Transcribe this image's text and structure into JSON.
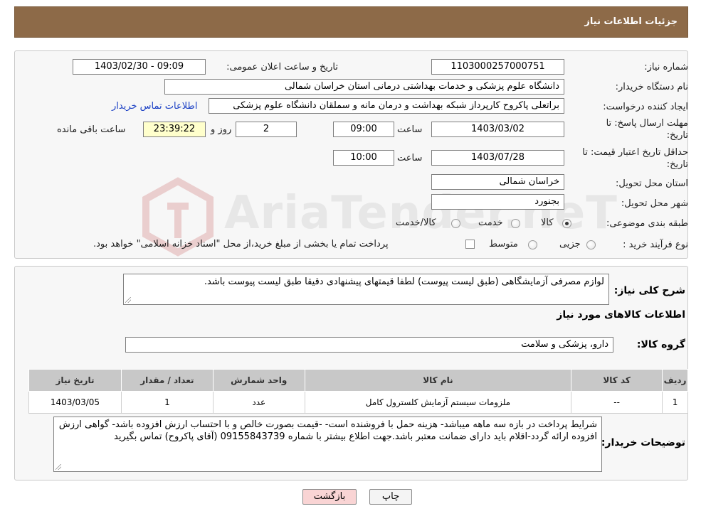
{
  "header": {
    "title": "جزئیات اطلاعات نیاز"
  },
  "watermark": {
    "brand": "AriaTender.neT"
  },
  "form": {
    "need_number": {
      "label": "شماره نیاز:",
      "value": "1103000257000751"
    },
    "announce_datetime": {
      "label": "تاریخ و ساعت اعلان عمومی:",
      "value": "1403/02/30 - 09:09"
    },
    "buyer_org": {
      "label": "نام دستگاه خریدار:",
      "value": "دانشگاه علوم پزشکی و خدمات بهداشتی درمانی استان خراسان شمالی"
    },
    "requester": {
      "label": "ایجاد کننده درخواست:",
      "value": "براتعلی پاکروح کارپرداز شبکه بهداشت و درمان مانه و سملقان دانشگاه علوم پزشکی",
      "contact_link": "اطلاعات تماس خریدار"
    },
    "deadline": {
      "label_line1": "مهلت ارسال پاسخ: تا",
      "label_line2": "تاریخ:",
      "date": "1403/03/02",
      "time_label": "ساعت",
      "time": "09:00",
      "days": "2",
      "days_label": "روز و",
      "remaining": "23:39:22",
      "remaining_label": "ساعت باقی مانده"
    },
    "price_validity": {
      "label_line1": "حداقل تاریخ اعتبار قیمت: تا",
      "label_line2": "تاریخ:",
      "date": "1403/07/28",
      "time_label": "ساعت",
      "time": "10:00"
    },
    "delivery_province": {
      "label": "استان محل تحویل:",
      "value": "خراسان شمالی"
    },
    "delivery_city": {
      "label": "شهر محل تحویل:",
      "value": "بجنورد"
    },
    "category": {
      "label": "طبقه بندی موضوعی:",
      "options": [
        "کالا",
        "خدمت",
        "کالا/خدمت"
      ],
      "selected": "کالا"
    },
    "purchase_process": {
      "label": "نوع فرآیند خرید :",
      "options": [
        "جزیی",
        "متوسط"
      ],
      "note": "پرداخت تمام یا بخشی از مبلغ خرید،از محل \"اسناد خزانه اسلامی\" خواهد بود."
    }
  },
  "summary": {
    "label": "شرح کلی نیاز:",
    "value": "لوازم مصرفی آزمایشگاهی (طبق لیست پیوست) لطفا قیمتهای پیشنهادی دقیقا طبق لیست پیوست باشد."
  },
  "goods_section": {
    "title": "اطلاعات کالاهای مورد نیاز"
  },
  "goods_group": {
    "label": "گروه کالا:",
    "value": "دارو، پزشکی و سلامت"
  },
  "table": {
    "headers": [
      "ردیف",
      "کد کالا",
      "نام کالا",
      "واحد شمارش",
      "تعداد / مقدار",
      "تاریخ نیاز"
    ],
    "rows": [
      [
        "1",
        "--",
        "ملزومات سیستم آزمایش کلسترول کامل",
        "عدد",
        "1",
        "1403/03/05"
      ]
    ]
  },
  "buyer_notes": {
    "label": "توضیحات خریدار:",
    "value": "شرایط پرداخت در بازه سه ماهه میباشد- هزینه حمل با فروشنده است- -قیمت بصورت خالص و با احتساب ارزش افزوده باشد- گواهی ارزش افزوده ارائه گردد-اقلام باید دارای ضمانت معتبر باشد.جهت اطلاع بیشتر با شماره 09155843739 (آقای پاکروح) تماس بگیرید"
  },
  "buttons": {
    "print": "چاپ",
    "back": "بازگشت"
  },
  "colors": {
    "header_bg": "#8d6a48",
    "link": "#1a3fc4",
    "back_btn_bg": "#f9d4d4",
    "remaining_bg": "#ffffcc"
  }
}
